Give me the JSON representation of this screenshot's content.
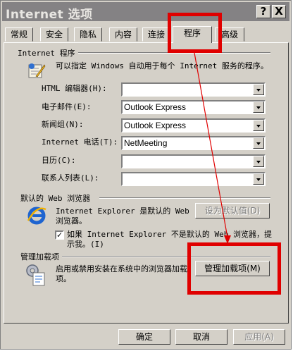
{
  "window": {
    "title": "Internet 选项",
    "help_btn": "?",
    "close_btn": "X"
  },
  "tabs": [
    "常规",
    "安全",
    "隐私",
    "内容",
    "连接",
    "程序",
    "高级"
  ],
  "programs": {
    "group_label": "Internet 程序",
    "description": "可以指定 Windows 自动用于每个 Internet 服务的程序。",
    "rows": [
      {
        "label": "HTML 编辑器(H):",
        "value": ""
      },
      {
        "label": "电子邮件(E):",
        "value": "Outlook Express"
      },
      {
        "label": "新闻组(N):",
        "value": "Outlook Express"
      },
      {
        "label": "Internet 电话(T):",
        "value": "NetMeeting"
      },
      {
        "label": "日历(C):",
        "value": ""
      },
      {
        "label": "联系人列表(L):",
        "value": ""
      }
    ]
  },
  "browser": {
    "group_label": "默认的 Web 浏览器",
    "status": "Internet Explorer 是默认的 Web 浏览器。",
    "set_default": "设为默认值(D)",
    "check_text": "如果 Internet Explorer 不是默认的 Web 浏览器，提示我。(I)",
    "checked": true
  },
  "addons": {
    "group_label": "管理加载项",
    "description": "启用或禁用安装在系统中的浏览器加载项。",
    "manage": "管理加载项(M)"
  },
  "footer": {
    "ok": "确定",
    "cancel": "取消",
    "apply": "应用(A)"
  },
  "colors": {
    "highlight": "#e00000",
    "titlebar": "#848284",
    "face": "#d4d0c8"
  }
}
